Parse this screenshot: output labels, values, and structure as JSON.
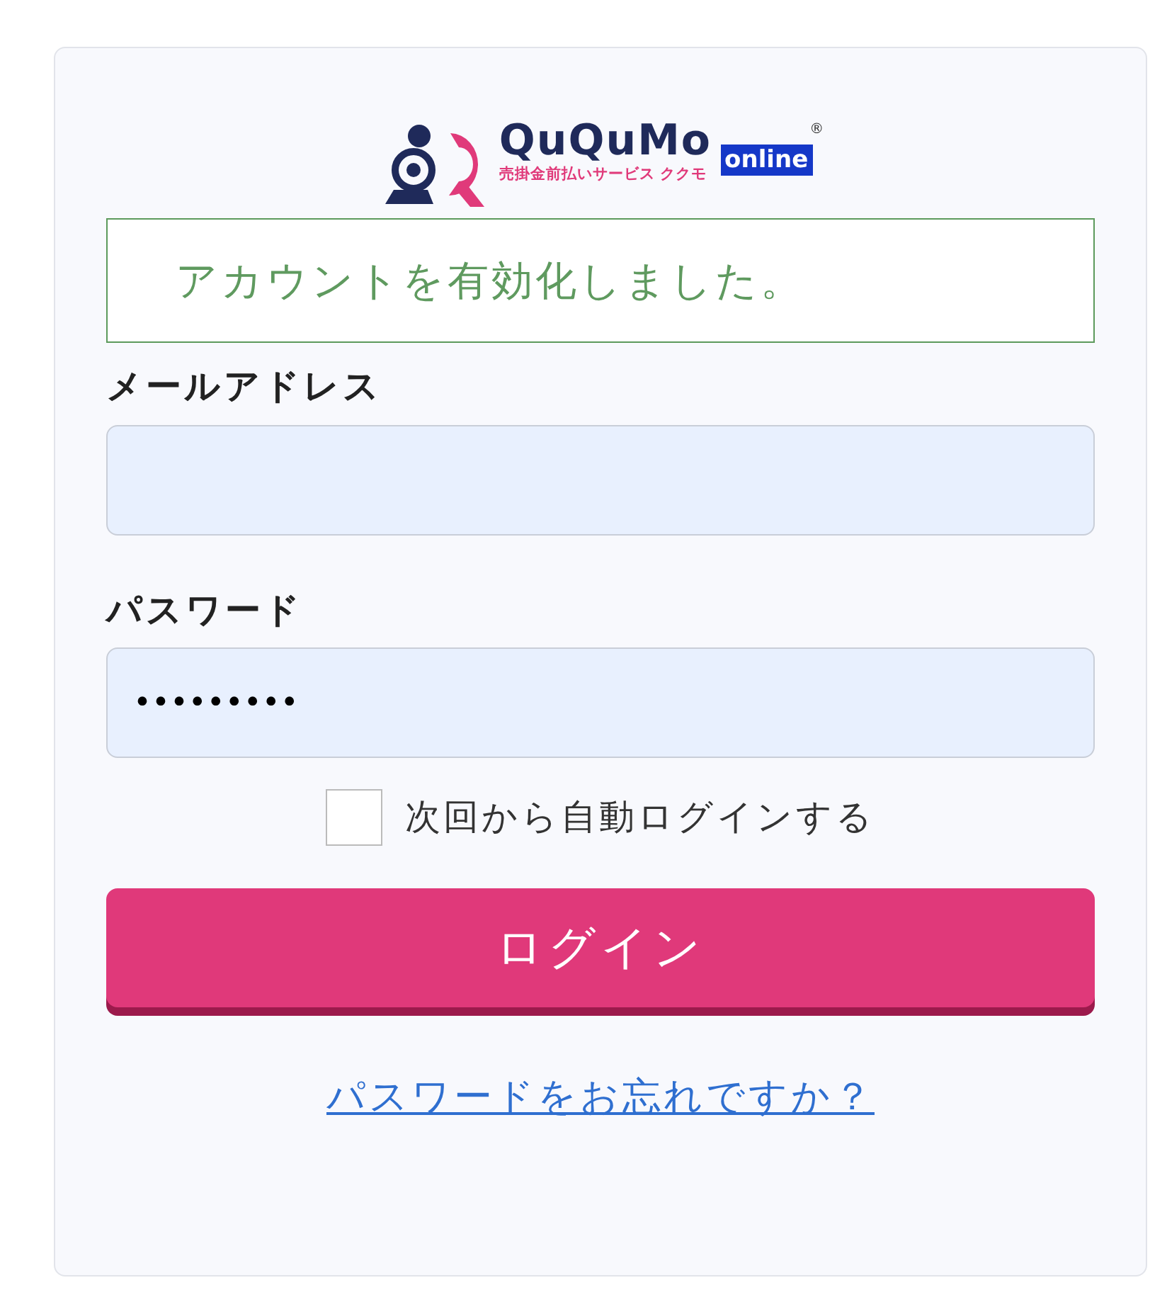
{
  "logo": {
    "brand": "QuQuMo",
    "badge": "online",
    "registered": "®",
    "tagline": "売掛金前払いサービス ククモ"
  },
  "alert": {
    "text": "アカウントを有効化しました。"
  },
  "fields": [
    {
      "label": "メールアドレス"
    },
    {
      "label": "パスワード",
      "value": "•••••••••"
    }
  ],
  "remember": {
    "label": "次回から自動ログインする",
    "checked": false
  },
  "login_button": "ログイン",
  "forgot_link": "パスワードをお忘れですか？"
}
